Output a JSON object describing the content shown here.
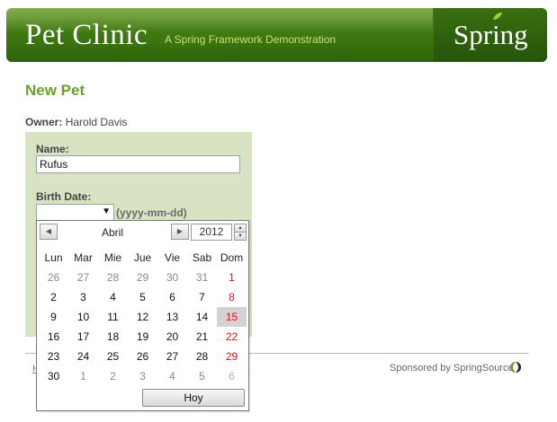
{
  "header": {
    "title": "Pet Clinic",
    "subtitle": "A Spring Framework Demonstration",
    "logo": "Spring"
  },
  "page_title": "New Pet",
  "owner": {
    "label": "Owner:",
    "name": "Harold Davis"
  },
  "form": {
    "name_label": "Name:",
    "name_value": "Rufus",
    "birth_label": "Birth Date:",
    "date_hint": "(yyyy-mm-dd)"
  },
  "calendar": {
    "month": "Abril",
    "year": "2012",
    "weekdays": [
      "Lun",
      "Mar",
      "Mie",
      "Jue",
      "Vie",
      "Sab",
      "Dom"
    ],
    "weeks": [
      [
        "26",
        "27",
        "28",
        "29",
        "30",
        "31",
        "1"
      ],
      [
        "2",
        "3",
        "4",
        "5",
        "6",
        "7",
        "8"
      ],
      [
        "9",
        "10",
        "11",
        "12",
        "13",
        "14",
        "15"
      ],
      [
        "16",
        "17",
        "18",
        "19",
        "20",
        "21",
        "22"
      ],
      [
        "23",
        "24",
        "25",
        "26",
        "27",
        "28",
        "29"
      ],
      [
        "30",
        "1",
        "2",
        "3",
        "4",
        "5",
        "6"
      ]
    ],
    "selected_day": "15",
    "today_label": "Hoy",
    "colors": {
      "weekend": "#d21616",
      "selected_bg": "#d3d3d3"
    }
  },
  "footer": {
    "link_fragment": "H",
    "sponsored": "Sponsored by SpringSource"
  },
  "colors": {
    "brand_green": "#3f7a12",
    "title_green": "#6aa12a",
    "panel": "#d8e3c3"
  }
}
